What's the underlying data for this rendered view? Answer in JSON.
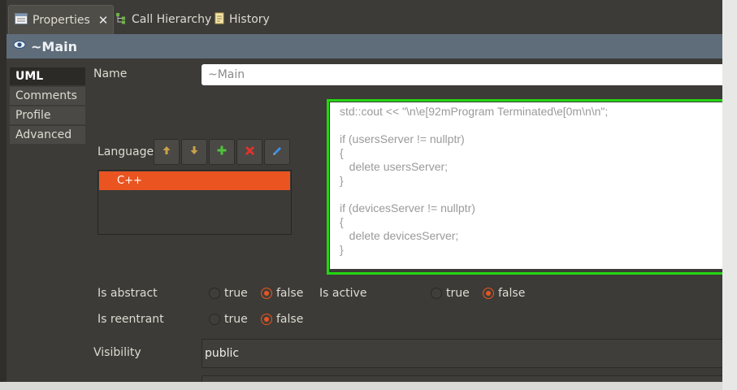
{
  "tabs": [
    {
      "label": "Properties",
      "icon": "properties-icon",
      "active": true
    },
    {
      "label": "Call Hierarchy",
      "icon": "call-hierarchy-icon",
      "active": false
    },
    {
      "label": "History",
      "icon": "history-icon",
      "active": false
    }
  ],
  "header": {
    "title": "~Main",
    "icon": "operation-icon"
  },
  "nav": {
    "items": [
      {
        "label": "UML",
        "selected": true
      },
      {
        "label": "Comments",
        "selected": false
      },
      {
        "label": "Profile",
        "selected": false
      },
      {
        "label": "Advanced",
        "selected": false
      }
    ]
  },
  "form": {
    "name_label": "Name",
    "name_value": "~Main",
    "language_label": "Language",
    "toolbar_icons": [
      "move-up-icon",
      "move-down-icon",
      "add-icon",
      "delete-icon",
      "edit-icon"
    ],
    "languages": [
      "C++"
    ],
    "code_lines": [
      "std::cout << \"\\n\\e[92mProgram Terminated\\e[0m\\n\\n\";",
      "",
      "if (usersServer != nullptr)",
      "{",
      "   delete usersServer;",
      "}",
      "",
      "if (devicesServer != nullptr)",
      "{",
      "   delete devicesServer;",
      "}"
    ],
    "is_abstract": {
      "label": "Is abstract",
      "true_label": "true",
      "false_label": "false",
      "value": false
    },
    "is_active": {
      "label": "Is active",
      "true_label": "true",
      "false_label": "false",
      "value": false
    },
    "is_reentrant": {
      "label": "Is reentrant",
      "true_label": "true",
      "false_label": "false",
      "value": false
    },
    "visibility_label": "Visibility",
    "visibility_value": "public"
  },
  "colors": {
    "accent": "#e95420",
    "highlight": "#25d613",
    "header": "#5f6d7a"
  }
}
